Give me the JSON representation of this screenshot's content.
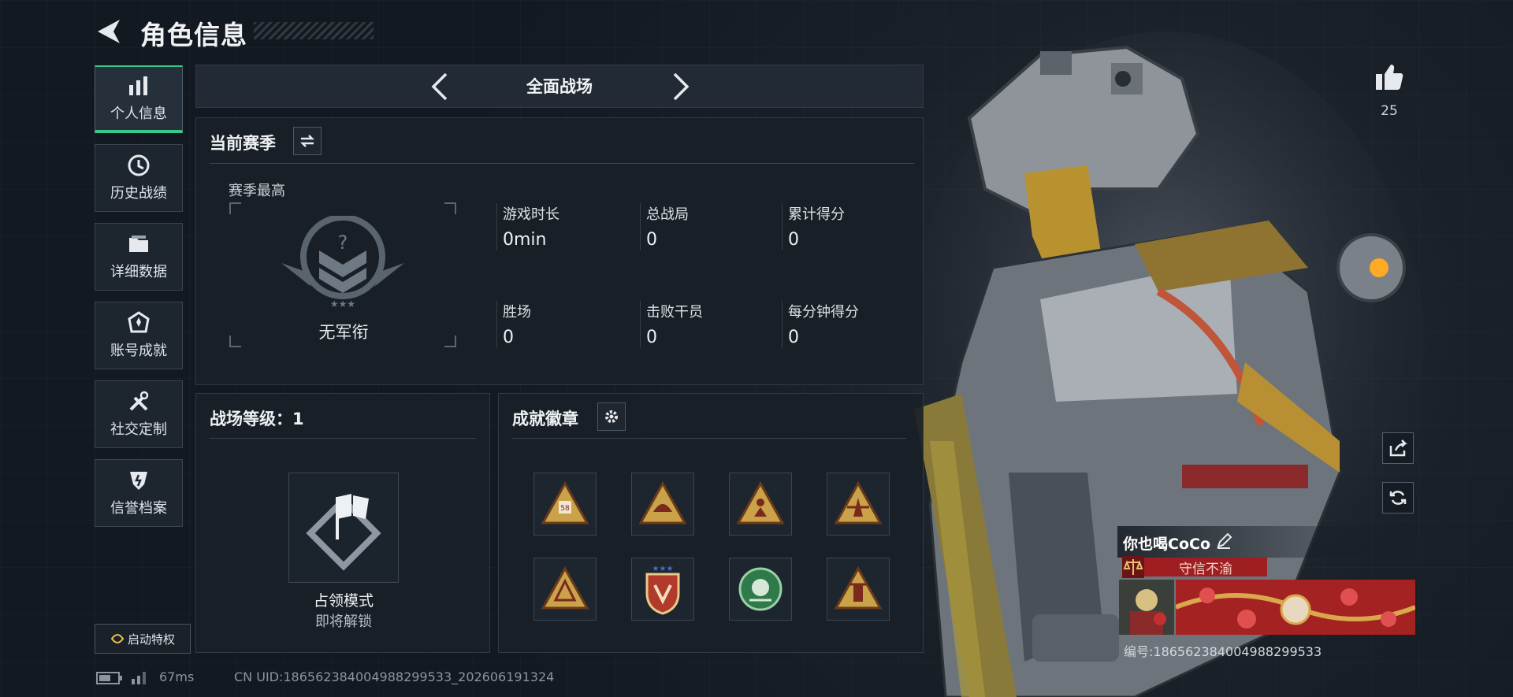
{
  "header": {
    "title": "角色信息"
  },
  "nav": {
    "items": [
      {
        "label": "个人信息",
        "icon": "bar-chart-icon",
        "active": true
      },
      {
        "label": "历史战绩",
        "icon": "history-clock-icon"
      },
      {
        "label": "详细数据",
        "icon": "folder-icon"
      },
      {
        "label": "账号成就",
        "icon": "achievement-medal-icon"
      },
      {
        "label": "社交定制",
        "icon": "tools-icon"
      },
      {
        "label": "信誉档案",
        "icon": "reputation-shield-icon"
      }
    ],
    "privilege_label": "启动特权"
  },
  "mode_selector": {
    "current": "全面战场"
  },
  "season": {
    "title": "当前赛季",
    "highest_label": "赛季最高",
    "rank_name": "无军衔",
    "stats": [
      {
        "label": "游戏时长",
        "value": "0min"
      },
      {
        "label": "总战局",
        "value": "0"
      },
      {
        "label": "累计得分",
        "value": "0"
      },
      {
        "label": "胜场",
        "value": "0"
      },
      {
        "label": "击败干员",
        "value": "0"
      },
      {
        "label": "每分钟得分",
        "value": "0"
      }
    ]
  },
  "battlefield_level": {
    "title": "战场等级：1",
    "mode_name": "占领模式",
    "mode_status": "即将解锁"
  },
  "achievements": {
    "title": "成就徽章",
    "badges": [
      "badge-58-icon",
      "badge-helmet-icon",
      "badge-soldier-icon",
      "badge-figure-icon",
      "badge-triangle-icon",
      "badge-stars-shield-icon",
      "badge-green-orb-icon",
      "badge-tower-icon"
    ]
  },
  "profile": {
    "likes": "25",
    "player_name": "你也喝CoCo",
    "honor": "守信不渝",
    "player_id": "编号:1865623840049882995​33"
  },
  "status_bar": {
    "ping": "67ms",
    "uid": "CN UID:18656238400498829​9533_202606191324"
  },
  "colors": {
    "accent_green": "#38c98a",
    "honor_red": "#9e1e22",
    "badge_gold": "#c9a24a"
  }
}
